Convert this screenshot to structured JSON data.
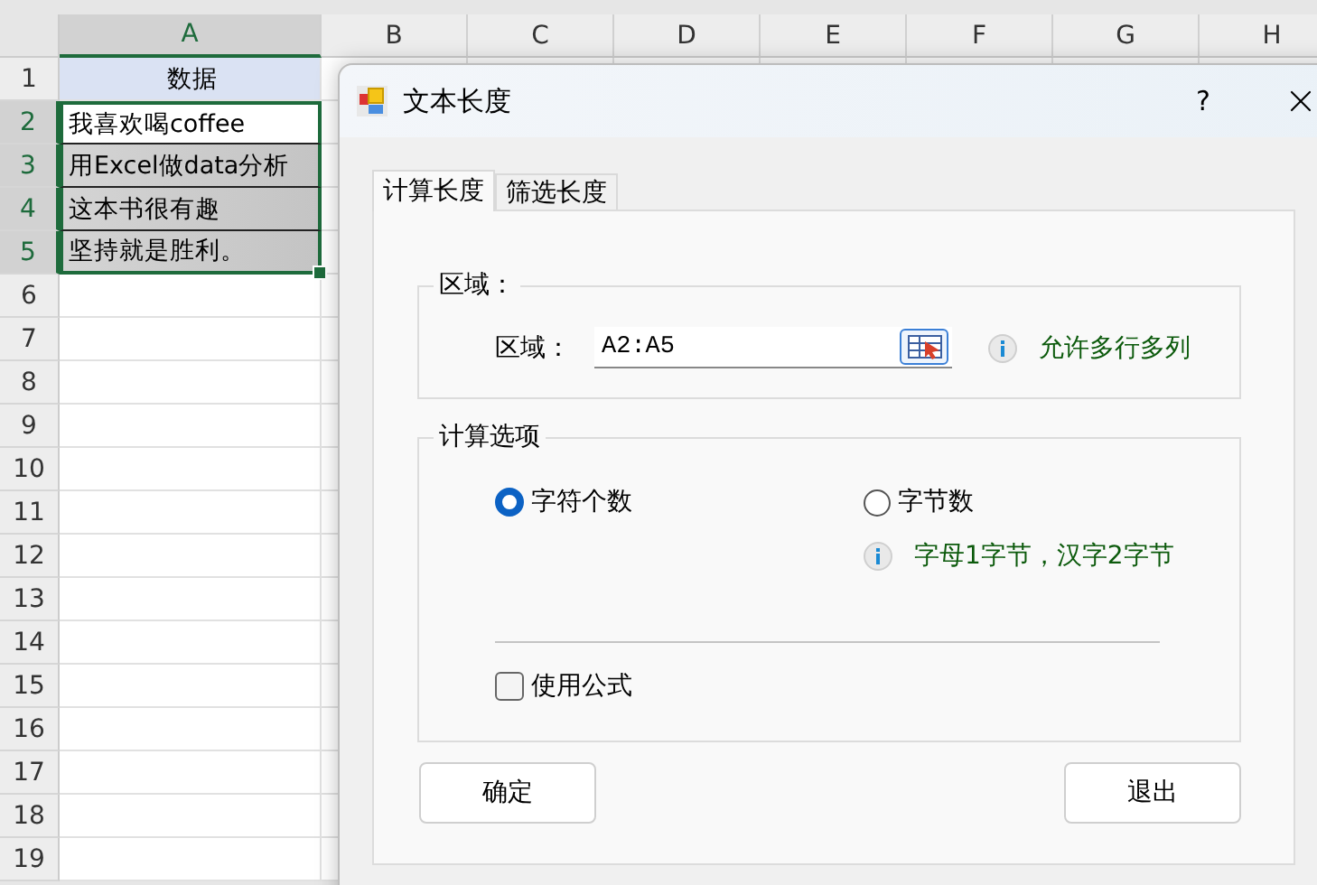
{
  "sheet": {
    "columns": [
      "A",
      "B",
      "C",
      "D",
      "E",
      "F",
      "G",
      "H"
    ],
    "rows": [
      "1",
      "2",
      "3",
      "4",
      "5",
      "6",
      "7",
      "8",
      "9",
      "10",
      "11",
      "12",
      "13",
      "14",
      "15",
      "16",
      "17",
      "18",
      "19"
    ],
    "cells": [
      {
        "text": "数据",
        "kind": "header"
      },
      {
        "text": "我喜欢喝coffee",
        "kind": "plain"
      },
      {
        "text": "用Excel做data分析",
        "kind": "shaded"
      },
      {
        "text": "这本书很有趣",
        "kind": "shaded"
      },
      {
        "text": "坚持就是胜利。",
        "kind": "shaded"
      }
    ]
  },
  "dialog": {
    "title": "文本长度",
    "help": "?",
    "tabs": [
      {
        "label": "计算长度",
        "selected": true
      },
      {
        "label": "筛选长度",
        "selected": false
      }
    ],
    "range_group": {
      "title": "区域：",
      "label": "区域：",
      "value": "A2:A5",
      "hint": "允许多行多列"
    },
    "options_group": {
      "title": "计算选项",
      "radios": [
        {
          "label": "字符个数",
          "selected": true
        },
        {
          "label": "字节数",
          "selected": false
        }
      ],
      "hint": "字母1字节，汉字2字节",
      "checkbox": {
        "label": "使用公式",
        "checked": false
      }
    },
    "buttons": [
      "确定",
      "退出"
    ]
  }
}
